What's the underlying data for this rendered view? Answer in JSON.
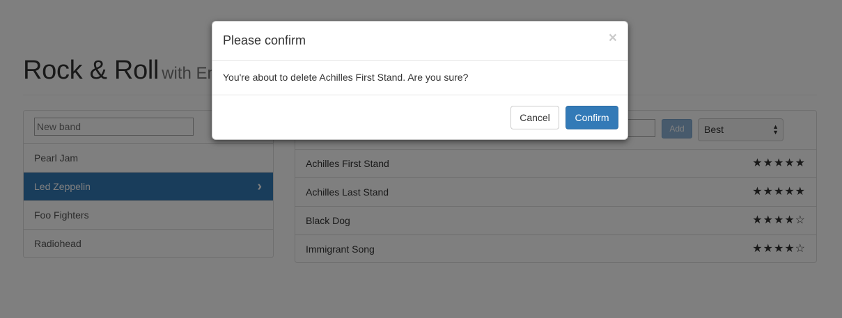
{
  "header": {
    "title": "Rock & Roll",
    "subtitle": "with Em"
  },
  "bands": {
    "new_band_placeholder": "New band",
    "items": [
      {
        "label": "Pearl Jam"
      },
      {
        "label": "Led Zeppelin",
        "active": true
      },
      {
        "label": "Foo Fighters"
      },
      {
        "label": "Radiohead"
      }
    ],
    "active_chevron": "›"
  },
  "songs": {
    "add_label": "Add",
    "sort_selected": "Best",
    "rows": [
      {
        "title": "Achilles First Stand",
        "rating": 5,
        "stars": "★★★★★"
      },
      {
        "title": "Achilles Last Stand",
        "rating": 5,
        "stars": "★★★★★"
      },
      {
        "title": "Black Dog",
        "rating": 4,
        "stars": "★★★★☆"
      },
      {
        "title": "Immigrant Song",
        "rating": 4,
        "stars": "★★★★☆"
      }
    ]
  },
  "modal": {
    "title": "Please confirm",
    "close_glyph": "×",
    "body": "You're about to delete Achilles First Stand. Are you sure?",
    "cancel_label": "Cancel",
    "confirm_label": "Confirm"
  },
  "colors": {
    "primary": "#337ab7",
    "backdrop": "rgba(0,0,0,0.5)"
  }
}
